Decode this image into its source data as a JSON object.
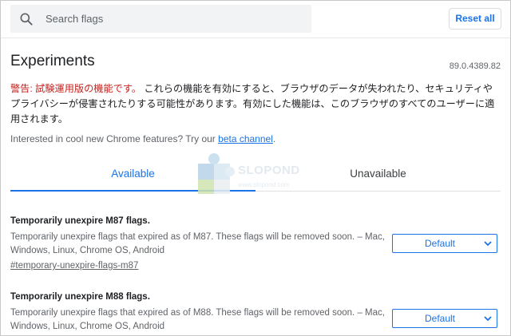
{
  "header": {
    "search_placeholder": "Search flags",
    "reset_label": "Reset all"
  },
  "page": {
    "title": "Experiments",
    "version": "89.0.4389.82",
    "warning_prefix": "警告: 試験運用版の機能です。",
    "warning_body": " これらの機能を有効にすると、ブラウザのデータが失われたり、セキュリティやプライバシーが侵害されたりする可能性があります。有効にした機能は、このブラウザのすべてのユーザーに適用されます。",
    "interested_text": "Interested in cool new Chrome features? Try our ",
    "beta_link": "beta channel",
    "interested_suffix": "."
  },
  "tabs": [
    {
      "label": "Available",
      "active": true
    },
    {
      "label": "Unavailable",
      "active": false
    }
  ],
  "watermark": {
    "name": "SLOPOND",
    "url": "www.slopond.com"
  },
  "experiments": [
    {
      "title": "Temporarily unexpire M87 flags.",
      "description": "Temporarily unexpire flags that expired as of M87. These flags will be removed soon. – Mac, Windows, Linux, Chrome OS, Android",
      "link": "#temporary-unexpire-flags-m87",
      "value": "Default"
    },
    {
      "title": "Temporarily unexpire M88 flags.",
      "description": "Temporarily unexpire flags that expired as of M88. These flags will be removed soon. – Mac, Windows, Linux, Chrome OS, Android",
      "value": "Default"
    }
  ],
  "icons": {
    "search": "search-icon",
    "dropdown": "chevron-down-icon"
  },
  "colors": {
    "accent": "#1a73e8",
    "warning": "#c5221f"
  }
}
